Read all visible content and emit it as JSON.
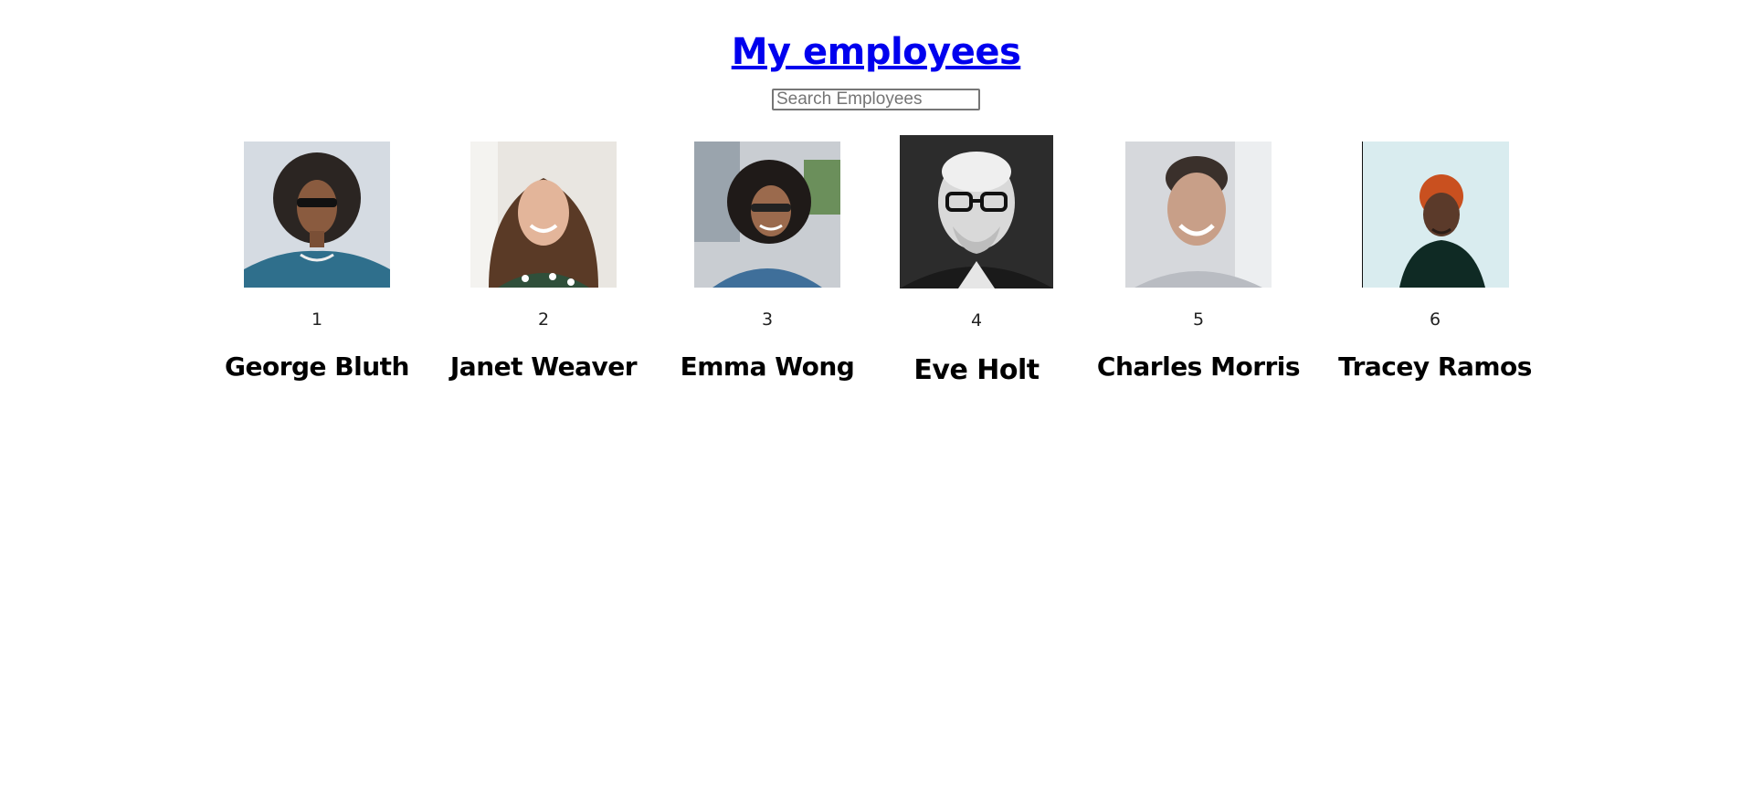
{
  "header": {
    "title": "My employees"
  },
  "search": {
    "placeholder": "Search Employees",
    "value": ""
  },
  "employees": [
    {
      "id": "1",
      "name": "George Bluth",
      "avatar_icon": "avatar-photo"
    },
    {
      "id": "2",
      "name": "Janet Weaver",
      "avatar_icon": "avatar-photo"
    },
    {
      "id": "3",
      "name": "Emma Wong",
      "avatar_icon": "avatar-photo"
    },
    {
      "id": "4",
      "name": "Eve Holt",
      "avatar_icon": "avatar-photo"
    },
    {
      "id": "5",
      "name": "Charles Morris",
      "avatar_icon": "avatar-photo"
    },
    {
      "id": "6",
      "name": "Tracey Ramos",
      "avatar_icon": "avatar-photo"
    }
  ],
  "colors": {
    "link": "#0000ee",
    "background": "#ffffff"
  }
}
